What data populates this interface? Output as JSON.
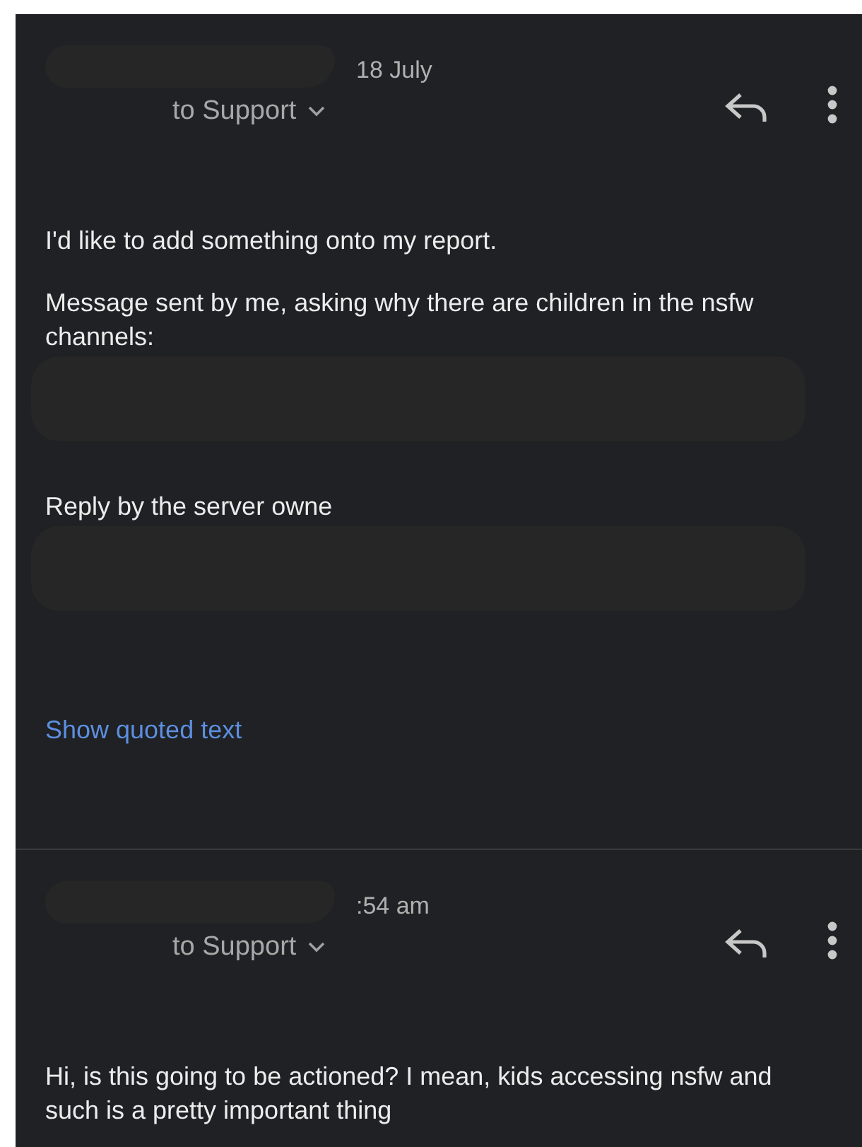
{
  "messages": [
    {
      "time": "18 July",
      "recipient": "to Support",
      "body": [
        {
          "kind": "text",
          "text": "I'd like to add something onto my report.",
          "redacted_after": false
        },
        {
          "kind": "text",
          "text": "Message sent by me, asking why there are children in the nsfw channels:",
          "redacted_after": true
        },
        {
          "kind": "text",
          "text": "Reply by the server owne",
          "redacted_after": true
        }
      ],
      "show_quoted": "Show quoted text"
    },
    {
      "time": ":54 am",
      "recipient": "to Support",
      "body": [
        {
          "kind": "text",
          "text": "Hi, is this going to be actioned? I mean, kids accessing nsfw and such is a pretty important thing",
          "redacted_after": false
        }
      ]
    }
  ]
}
